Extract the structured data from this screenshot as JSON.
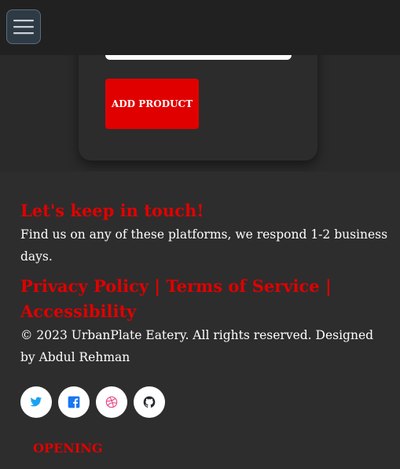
{
  "form": {
    "add_button_label": "ADD PRODUCT"
  },
  "footer": {
    "heading": "Let's keep in touch!",
    "text": "Find us on any of these platforms, we respond 1-2 business days.",
    "links": [
      "Privacy Policy",
      "Terms of Service",
      "Accessibility"
    ],
    "separator": " | ",
    "copyright": "© 2023 UrbanPlate Eatery. All rights reserved. Designed by Abdul Rehman",
    "socials": [
      {
        "name": "twitter",
        "icon": "twitter-icon",
        "color": "#1da1f2"
      },
      {
        "name": "facebook",
        "icon": "facebook-square-icon",
        "color": "#1877f2"
      },
      {
        "name": "dribbble",
        "icon": "dribbble-icon",
        "color": "#ea4c89"
      },
      {
        "name": "github",
        "icon": "github-icon",
        "color": "#24292e"
      }
    ],
    "opening_heading": "OPENING"
  },
  "colors": {
    "accent": "#e00000",
    "background": "#2d2d2d"
  }
}
